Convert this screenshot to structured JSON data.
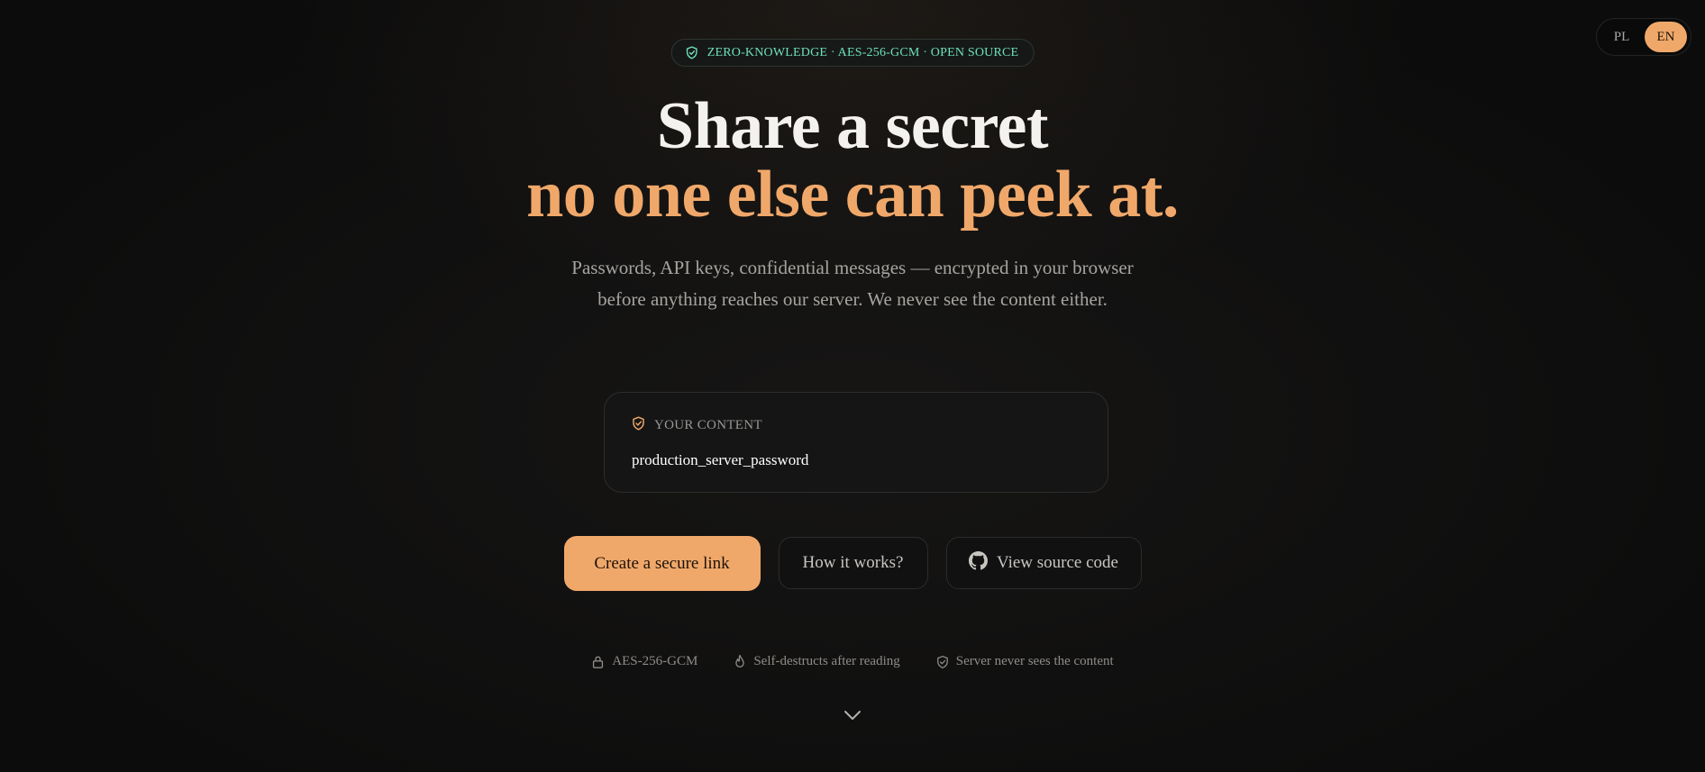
{
  "language_switch": {
    "options": [
      "PL",
      "EN"
    ],
    "selected": "EN"
  },
  "badge": {
    "text": "ZERO-KNOWLEDGE · AES-256-GCM · OPEN SOURCE",
    "icon": "shield-check-icon",
    "color": "#6fe0bc"
  },
  "hero": {
    "title_line1": "Share a secret",
    "title_line2": "no one else can peek at.",
    "subtitle": "Passwords, API keys, confidential messages — encrypted in your browser before anything reaches our server. We never see the content either."
  },
  "content_card": {
    "label": "YOUR CONTENT",
    "icon": "shield-check-icon",
    "value": "production_server_password"
  },
  "actions": {
    "primary_label": "Create a secure link",
    "how_label": "How it works?",
    "source_label": "View source code",
    "source_icon": "github-icon"
  },
  "features": [
    {
      "icon": "lock-icon",
      "label": "AES-256-GCM"
    },
    {
      "icon": "flame-icon",
      "label": "Self-destructs after reading"
    },
    {
      "icon": "shield-icon",
      "label": "Server never sees the content"
    }
  ],
  "scroll_icon": "chevron-down-icon",
  "colors": {
    "accent": "#f0a86a",
    "background": "#0f0f0f",
    "badge_green": "#6fe0bc"
  }
}
